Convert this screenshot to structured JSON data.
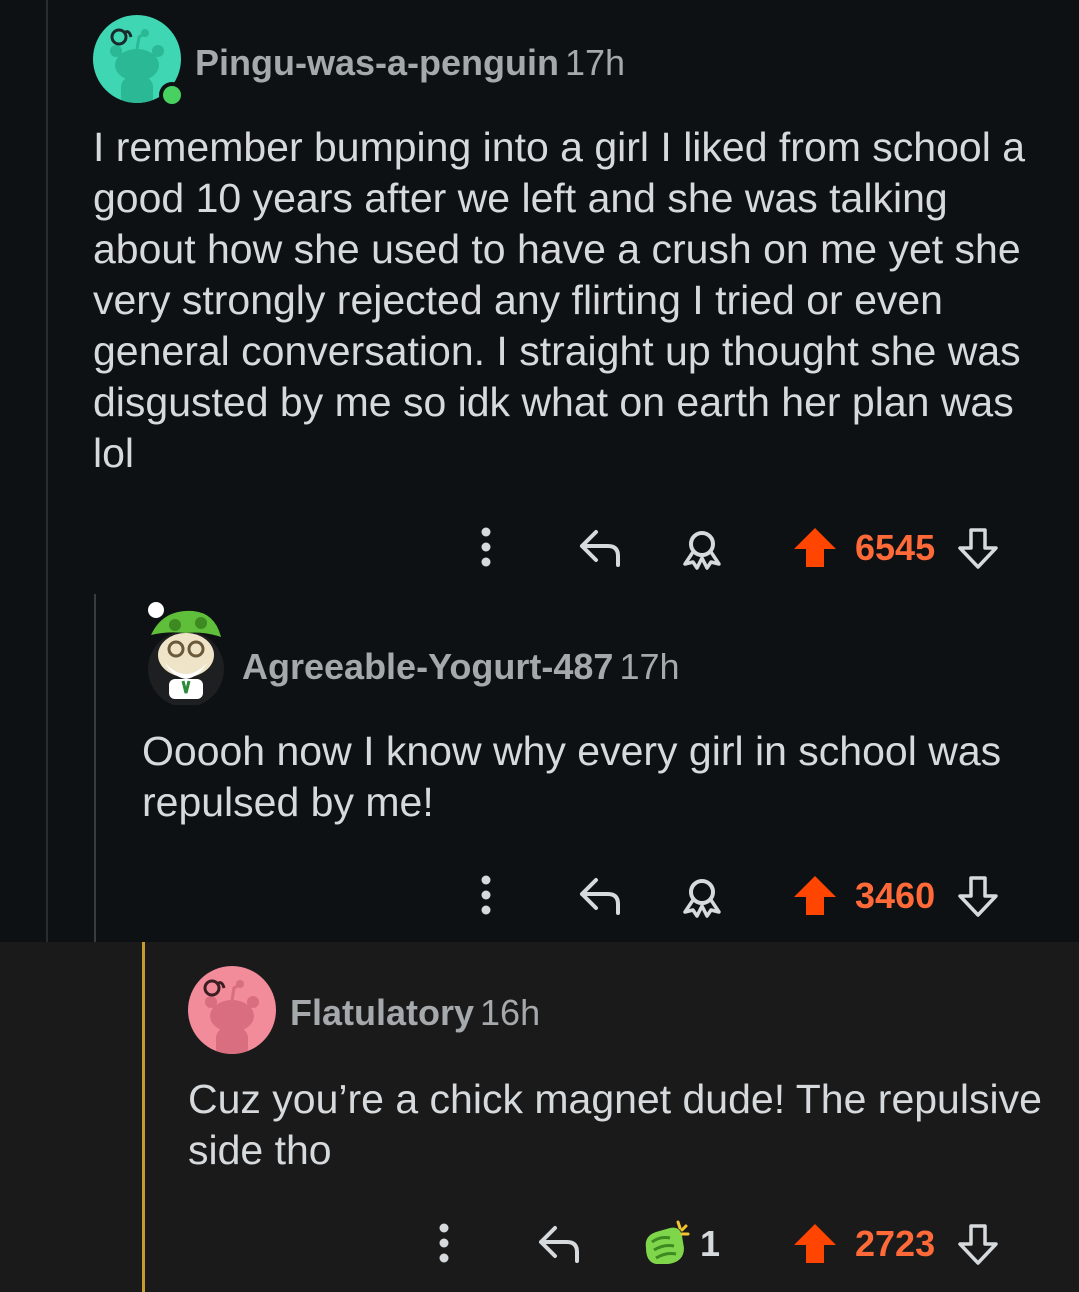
{
  "theme": {
    "background": "#0e1113",
    "text": "#d7dadc",
    "meta": "#a5a9ac",
    "upvote": "#ff4500",
    "score": "#ff6a38",
    "online": "#46d160"
  },
  "comments": [
    {
      "username": "Pingu-was-a-penguin",
      "time": "17h",
      "avatar_color": "#3fd7b3",
      "online": true,
      "body": "I remember bumping into a girl I liked from school a good 10 years after we left and she was talking about how she used to have a crush on me yet she very strongly rejected any flirting I tried or even general conversation. I straight up thought she was disgusted by me so idk what on earth her plan was lol",
      "score": "6545"
    },
    {
      "username": "Agreeable-Yogurt-487",
      "time": "17h",
      "body": "Ooooh now I know why every girl in school was repulsed by me!",
      "score": "3460"
    },
    {
      "username": "Flatulatory",
      "time": "16h",
      "avatar_color": "#f28b9a",
      "body": "Cuz you’re a chick magnet dude! The repulsive side tho",
      "award_count": "1",
      "score": "2723"
    }
  ],
  "icons": [
    "more-options-icon",
    "reply-icon",
    "award-icon",
    "upvote-icon",
    "downvote-icon"
  ]
}
